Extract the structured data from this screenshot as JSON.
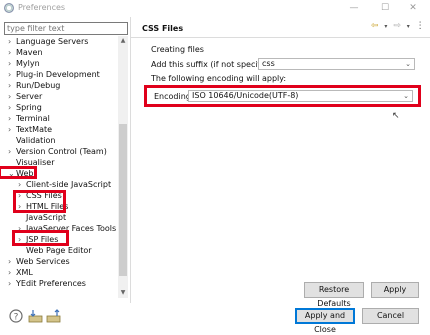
{
  "window": {
    "title": "Preferences",
    "minimize": "—",
    "maximize": "☐",
    "close": "✕"
  },
  "filter": {
    "placeholder": "type filter text"
  },
  "tree": {
    "items": [
      {
        "label": "Language Servers",
        "arrow": "›"
      },
      {
        "label": "Maven",
        "arrow": "›"
      },
      {
        "label": "Mylyn",
        "arrow": "›"
      },
      {
        "label": "Plug-in Development",
        "arrow": "›"
      },
      {
        "label": "Run/Debug",
        "arrow": "›"
      },
      {
        "label": "Server",
        "arrow": "›"
      },
      {
        "label": "Spring",
        "arrow": "›"
      },
      {
        "label": "Terminal",
        "arrow": "›"
      },
      {
        "label": "TextMate",
        "arrow": "›"
      },
      {
        "label": "Validation",
        "arrow": ""
      },
      {
        "label": "Version Control (Team)",
        "arrow": "›"
      },
      {
        "label": "Visualiser",
        "arrow": ""
      },
      {
        "label": "Web",
        "arrow": "⌄"
      },
      {
        "label": "Client-side JavaScript",
        "arrow": "›"
      },
      {
        "label": "CSS Files",
        "arrow": "›"
      },
      {
        "label": "HTML Files",
        "arrow": "›"
      },
      {
        "label": "JavaScript",
        "arrow": ""
      },
      {
        "label": "JavaServer Faces Tools",
        "arrow": "›"
      },
      {
        "label": "JSP Files",
        "arrow": "›"
      },
      {
        "label": "Web Page Editor",
        "arrow": ""
      },
      {
        "label": "Web Services",
        "arrow": "›"
      },
      {
        "label": "XML",
        "arrow": "›"
      },
      {
        "label": "YEdit Preferences",
        "arrow": "›"
      }
    ]
  },
  "page": {
    "title": "CSS Files",
    "tools": {
      "back": "⇦",
      "back_menu": "▾",
      "forward": "⇨",
      "forward_menu": "▾",
      "menu": "⋮"
    },
    "creating_files": "Creating files",
    "suffix_label": "Add this suffix (if not specified):",
    "suffix_value": "css",
    "encoding_note": "The following encoding will apply:",
    "encoding_label": "Encoding:",
    "encoding_value": "ISO 10646/Unicode(UTF-8)",
    "partial_label": "",
    "partial_value": ""
  },
  "buttons": {
    "restore_defaults": "Restore Defaults",
    "apply": "Apply",
    "apply_and_close": "Apply and Close",
    "cancel": "Cancel"
  },
  "bottom_icons": [
    "help-icon",
    "import-icon",
    "export-icon"
  ],
  "colors": {
    "highlight": "#e0001b",
    "accent": "#0078d7",
    "nav_arrows": "#c9a227"
  }
}
